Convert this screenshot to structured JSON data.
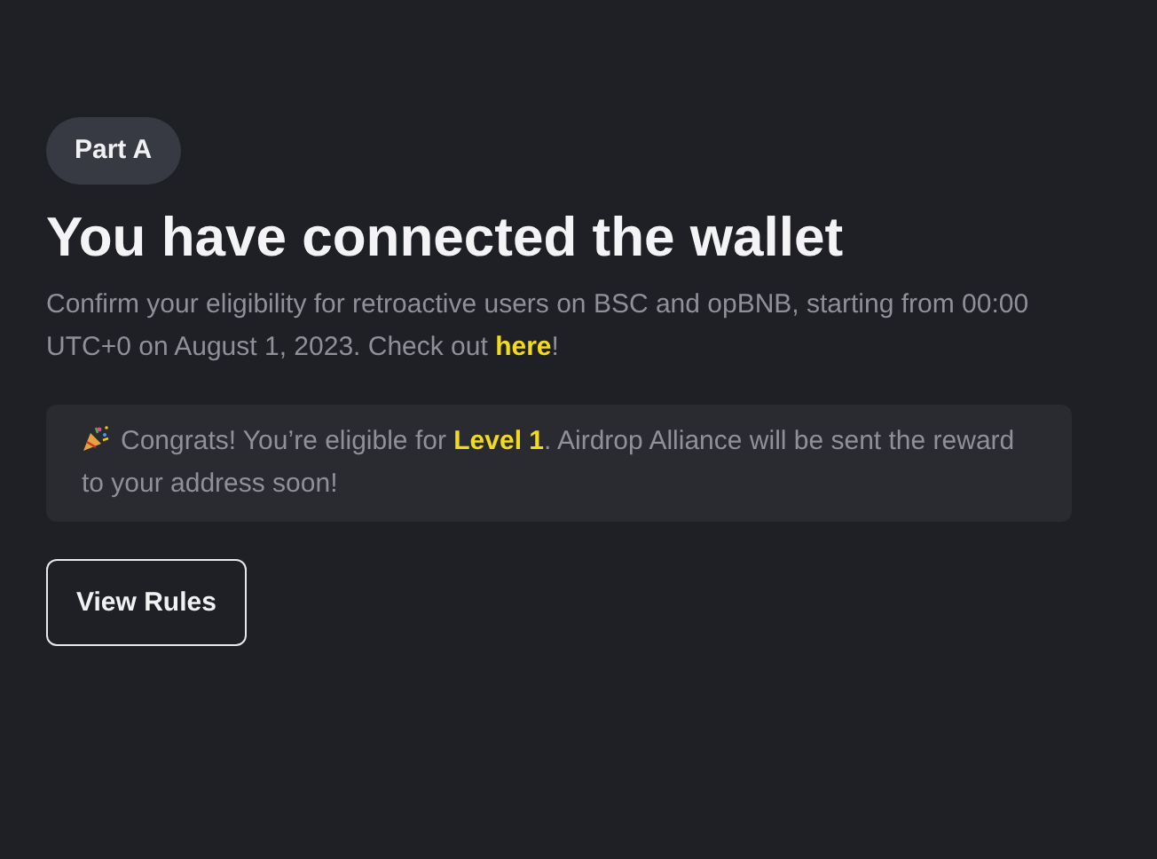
{
  "badge": "Part A",
  "title": "You have connected the wallet",
  "description": {
    "before": "Confirm your eligibility for retroactive users on BSC and opBNB, starting from 00:00 UTC+0 on August 1, 2023. Check out ",
    "link": "here",
    "after": "!"
  },
  "notice": {
    "before": "Congrats! You’re eligible for ",
    "highlight": "Level 1",
    "after": ". Airdrop Alliance will be sent the reward to your address soon!"
  },
  "button": "View Rules"
}
